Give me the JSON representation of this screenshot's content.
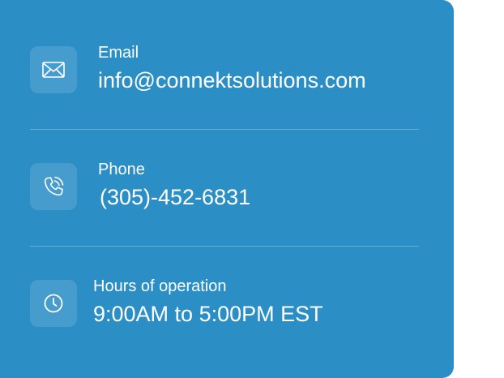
{
  "contact": {
    "email": {
      "label": "Email",
      "value": "info@connektsolutions.com",
      "icon": "envelope-icon"
    },
    "phone": {
      "label": "Phone",
      "value": "(305)-452-6831",
      "icon": "phone-icon"
    },
    "hours": {
      "label": "Hours of operation",
      "value": "9:00AM to 5:00PM EST",
      "icon": "clock-icon"
    }
  },
  "colors": {
    "card_background": "#2b8fc6",
    "text": "#ffffff",
    "icon_tile": "rgba(255,255,255,0.13)",
    "divider": "rgba(255,255,255,0.28)"
  }
}
